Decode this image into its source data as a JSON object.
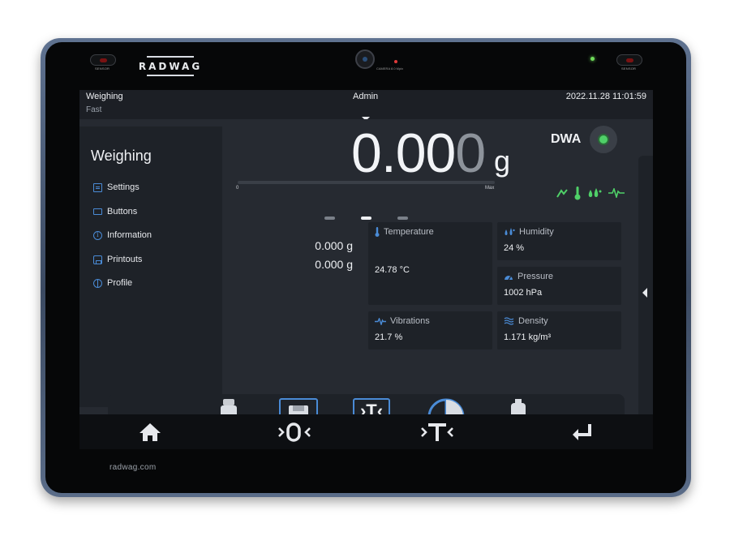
{
  "device": {
    "brand_logo": "RADWAG",
    "sensor_caption": "SENSOR",
    "camera_caption": "CAMERA 8.0 Mpix",
    "brand_url": "radwag.com"
  },
  "status_bar": {
    "mode_title": "Weighing",
    "mode_subtitle": "Fast",
    "user": "Admin",
    "datetime": "2022.11.28 11:01:59"
  },
  "side_menu": {
    "title": "Weighing",
    "items": [
      {
        "label": "Settings",
        "icon": "settings-doc-icon"
      },
      {
        "label": "Buttons",
        "icon": "keyboard-icon"
      },
      {
        "label": "Information",
        "icon": "info-icon"
      },
      {
        "label": "Printouts",
        "icon": "printer-icon"
      },
      {
        "label": "Profile",
        "icon": "profile-globe-icon"
      }
    ]
  },
  "weighing": {
    "value_main": "0.00",
    "value_last_digit": "0",
    "unit": "g",
    "bargraph_min": "0",
    "bargraph_max": "Max",
    "bargraph_fill": 0.0,
    "extra_rows": [
      "0.000 g",
      "0.000 g"
    ]
  },
  "dwa": {
    "label": "DWA",
    "indicator_color": "#4fd068"
  },
  "environment": {
    "temperature": {
      "label": "Temperature",
      "value": "24.78 °C"
    },
    "humidity": {
      "label": "Humidity",
      "value": "24 %"
    },
    "pressure": {
      "label": "Pressure",
      "value": "1002 hPa"
    },
    "vibrations": {
      "label": "Vibrations",
      "value": "21.7 %"
    },
    "density": {
      "label": "Density",
      "value": "1.171 kg/m³"
    }
  },
  "pager": {
    "pages": 3,
    "active": 1
  },
  "shortcuts": [
    "printout-icon",
    "save-data-icon",
    "tare-confirm-icon",
    "database-icon",
    "weight-adjust-icon"
  ],
  "bottom_nav": [
    "home-icon",
    "zero-icon",
    "tare-icon",
    "enter-icon"
  ],
  "colors": {
    "accent_blue": "#4a8bd6",
    "status_green": "#4fd068",
    "screen_bg": "#262a31"
  }
}
